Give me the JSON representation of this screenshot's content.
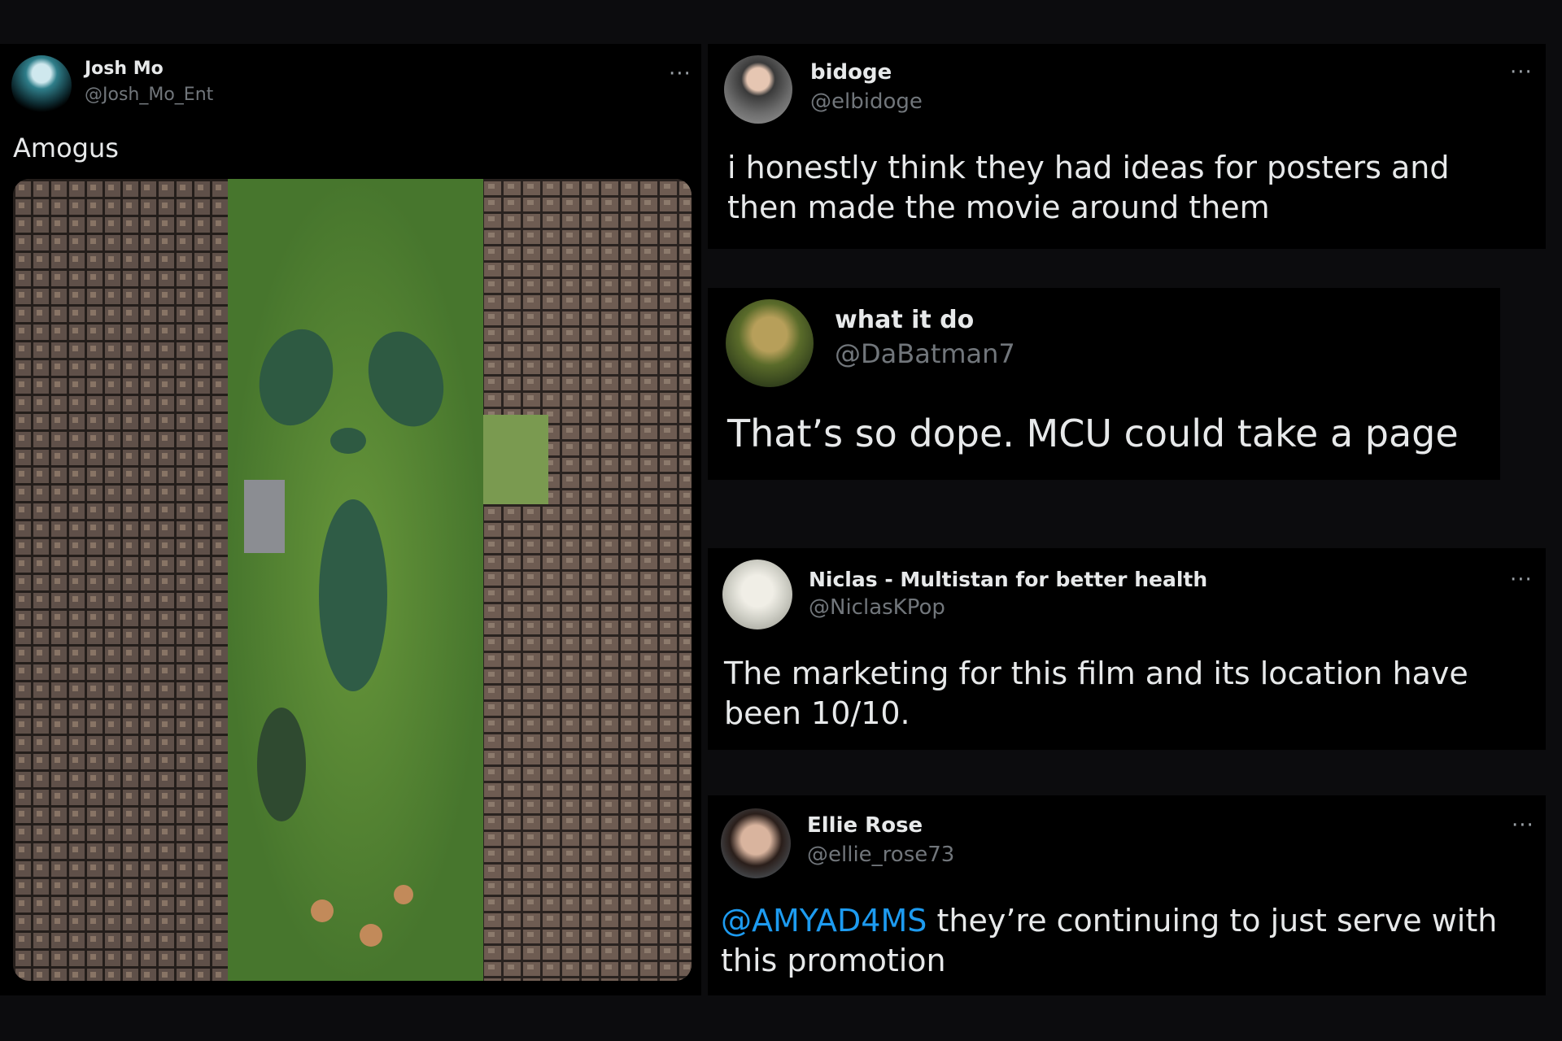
{
  "tweets": [
    {
      "name": "Josh Mo",
      "handle": "@Josh_Mo_Ent",
      "text": "Amogus",
      "more": "···"
    },
    {
      "name": "bidoge",
      "handle": "@elbidoge",
      "text": "i honestly think they had ideas for posters and then made the movie around them",
      "more": "···"
    },
    {
      "name": "what it do",
      "handle": "@DaBatman7",
      "text": "That’s so dope. MCU could take a page"
    },
    {
      "name": "Niclas - Multistan for better health",
      "handle": "@NiclasKPop",
      "text": "The marketing for this film and its location have been 10/10.",
      "more": "···"
    },
    {
      "name": "Ellie Rose",
      "handle": "@ellie_rose73",
      "mention": "@AMYAD4MS",
      "text": " they’re continuing to just serve with this promotion",
      "more": "···"
    }
  ],
  "colors": {
    "background": "#0c0c0e",
    "card": "#000000",
    "text": "#e7e9ea",
    "handle": "#71767b",
    "mention": "#1d9bf0"
  },
  "icons": [
    "more-icon",
    "avatar"
  ]
}
